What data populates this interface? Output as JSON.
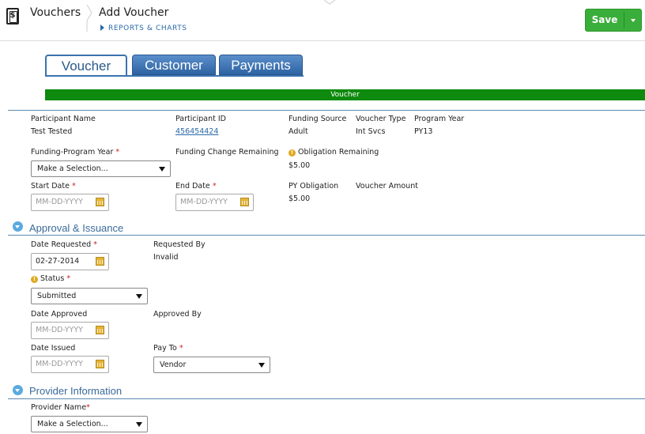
{
  "header": {
    "app_title": "Vouchers",
    "page_title": "Add Voucher",
    "reports_link": "REPORTS & CHARTS",
    "save_label": "Save"
  },
  "tabs": [
    {
      "label": "Voucher",
      "active": true
    },
    {
      "label": "Customer",
      "active": false
    },
    {
      "label": "Payments",
      "active": false
    }
  ],
  "banner": "Voucher",
  "summary": {
    "participant_name": {
      "label": "Participant Name",
      "value": "Test Tested"
    },
    "participant_id": {
      "label": "Participant ID",
      "value": "456454424"
    },
    "funding_source": {
      "label": "Funding Source",
      "value": "Adult"
    },
    "voucher_type": {
      "label": "Voucher Type",
      "value": "Int Svcs"
    },
    "program_year": {
      "label": "Program Year",
      "value": "PY13"
    }
  },
  "funding": {
    "funding_program_year": {
      "label": "Funding-Program Year",
      "value": "Make a Selection..."
    },
    "funding_change_remaining": {
      "label": "Funding Change Remaining"
    },
    "obligation_remaining": {
      "label": "Obligation Remaining",
      "value": "$5.00"
    },
    "start_date": {
      "label": "Start Date",
      "placeholder": "MM-DD-YYYY"
    },
    "end_date": {
      "label": "End Date",
      "placeholder": "MM-DD-YYYY"
    },
    "py_obligation": {
      "label": "PY Obligation",
      "value": "$5.00"
    },
    "voucher_amount": {
      "label": "Voucher Amount"
    }
  },
  "approval": {
    "title": "Approval & Issuance",
    "date_requested": {
      "label": "Date Requested",
      "value": "02-27-2014"
    },
    "requested_by": {
      "label": "Requested By",
      "value": "Invalid"
    },
    "status": {
      "label": "Status",
      "value": "Submitted"
    },
    "date_approved": {
      "label": "Date Approved",
      "placeholder": "MM-DD-YYYY"
    },
    "approved_by": {
      "label": "Approved By"
    },
    "date_issued": {
      "label": "Date Issued",
      "placeholder": "MM-DD-YYYY"
    },
    "pay_to": {
      "label": "Pay To",
      "value": "Vendor"
    }
  },
  "provider": {
    "title": "Provider Information",
    "provider_name": {
      "label": "Provider Name",
      "value": "Make a Selection..."
    }
  },
  "required_marker": "*",
  "colors": {
    "save_green": "#3aae3a",
    "banner_green": "#0e8a0e",
    "tab_blue": "#3a73b0",
    "link_blue": "#2a6aa8",
    "required_red": "#cc2222"
  },
  "icons": {
    "app": "voucher-document-icon",
    "info": "info-icon",
    "calendar": "calendar-icon",
    "section_toggle": "collapse-toggle-icon"
  }
}
